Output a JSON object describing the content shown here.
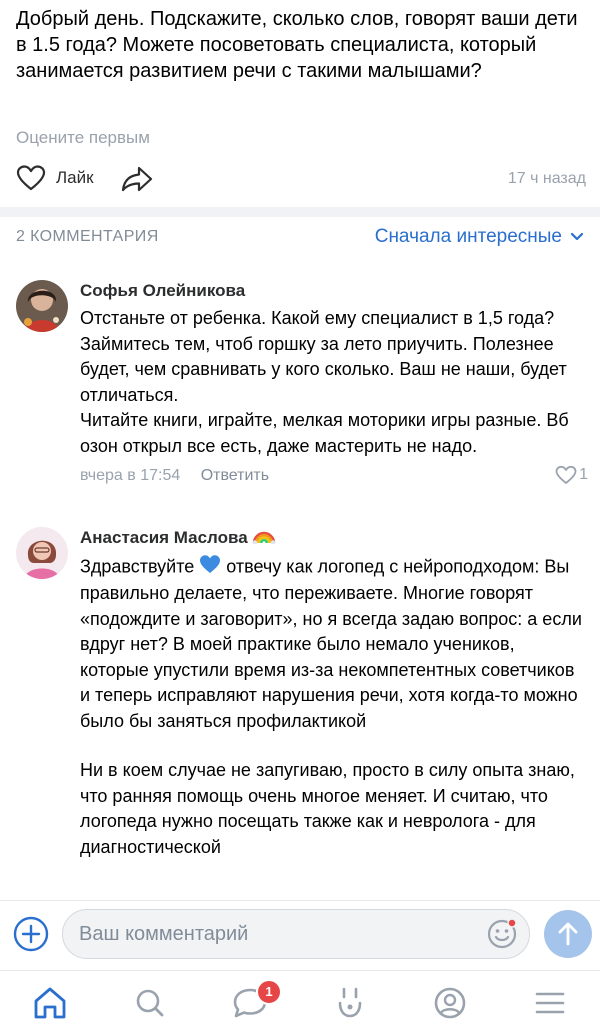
{
  "post": {
    "text": "Добрый день. Подскажите, сколько слов, говорят ваши дети в 1.5 года? Можете посоветовать специалиста, который занимается развитием речи с такими малышами?",
    "rate_label": "Оцените первым",
    "like_label": "Лайк",
    "time": "17 ч назад"
  },
  "comments_header": {
    "count_label": "2 КОММЕНТАРИЯ",
    "sort_label": "Сначала интересные"
  },
  "comments": [
    {
      "author": "Софья Олейникова",
      "text": "Отстаньте от ребенка. Какой ему специалист в 1,5 года? Займитесь тем, чтоб горшку за лето приучить. Полезнее будет, чем сравнивать у кого сколько. Ваш не наши, будет отличаться.\nЧитайте книги, играйте, мелкая моторики  игры разные. Вб озон открыл все есть, даже мастерить не надо.",
      "time": "вчера в 17:54",
      "reply_label": "Ответить",
      "likes": "1"
    },
    {
      "author": "Анастасия Маслова",
      "author_emoji": "rainbow-emoji",
      "text_part1": "Здравствуйте",
      "text_emoji": "blue-heart-emoji",
      "text_part2": " отвечу как логопед с нейроподходом: Вы правильно делаете, что переживаете. Многие говорят «подождите и заговорит», но я всегда задаю вопрос: а если вдруг нет?  В моей практике было немало учеников, которые упустили время из-за некомпетентных советчиков и теперь исправляют нарушения речи, хотя когда-то можно было бы заняться профилактикой",
      "text_paragraph2": "Ни в коем случае не запугиваю, просто в силу опыта знаю, что ранняя помощь очень многое меняет. И считаю, что логопеда нужно посещать также как и невролога - для диагностической"
    }
  ],
  "composer": {
    "placeholder": "Ваш комментарий"
  },
  "tabbar": {
    "items": [
      "home-icon",
      "search-icon",
      "messages-icon",
      "clips-icon",
      "profile-icon",
      "menu-icon"
    ],
    "messages_badge": "1"
  },
  "colors": {
    "accent": "#2a6fce",
    "secondary_text": "#818c99",
    "muted_text": "#99a2ad",
    "badge": "#e64646",
    "send_button": "#a5c4ec"
  }
}
